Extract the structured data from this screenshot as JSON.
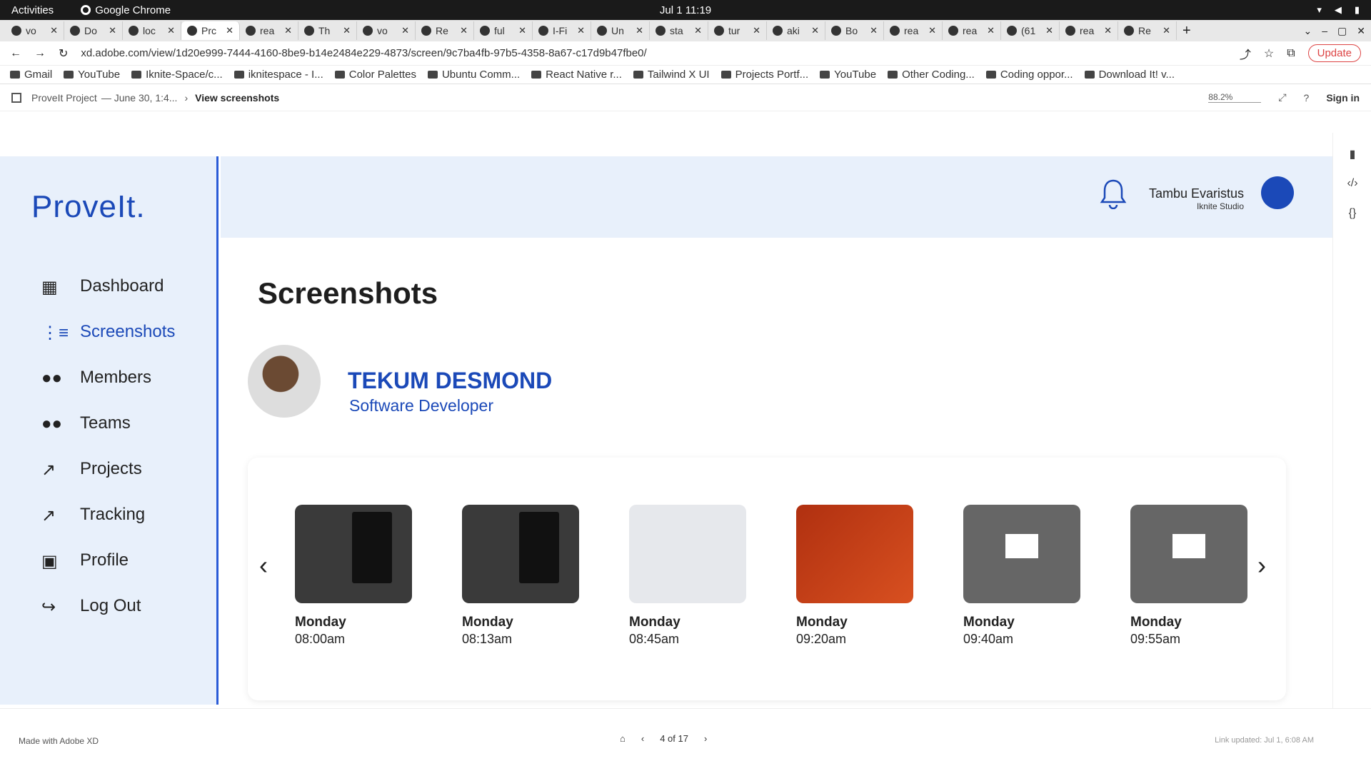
{
  "os": {
    "activities": "Activities",
    "app_name": "Google Chrome",
    "clock": "Jul 1  11:19"
  },
  "tabs": [
    {
      "label": "vo",
      "active": false
    },
    {
      "label": "Do",
      "active": false
    },
    {
      "label": "loc",
      "active": false
    },
    {
      "label": "Prc",
      "active": true
    },
    {
      "label": "rea",
      "active": false
    },
    {
      "label": "Th",
      "active": false
    },
    {
      "label": "vo",
      "active": false
    },
    {
      "label": "Re",
      "active": false
    },
    {
      "label": "ful",
      "active": false
    },
    {
      "label": "I-Fi",
      "active": false
    },
    {
      "label": "Un",
      "active": false
    },
    {
      "label": "sta",
      "active": false
    },
    {
      "label": "tur",
      "active": false
    },
    {
      "label": "aki",
      "active": false
    },
    {
      "label": "Bo",
      "active": false
    },
    {
      "label": "rea",
      "active": false
    },
    {
      "label": "rea",
      "active": false
    },
    {
      "label": "(61",
      "active": false
    },
    {
      "label": "rea",
      "active": false
    },
    {
      "label": "Re",
      "active": false
    }
  ],
  "address": {
    "url": "xd.adobe.com/view/1d20e999-7444-4160-8be9-b14e2484e229-4873/screen/9c7ba4fb-97b5-4358-8a67-c17d9b47fbe0/",
    "update_label": "Update"
  },
  "bookmarks": [
    "Gmail",
    "YouTube",
    "Iknite-Space/c...",
    "iknitespace - I...",
    "Color Palettes",
    "Ubuntu Comm...",
    "React Native r...",
    "Tailwind X UI",
    "Projects Portf...",
    "YouTube",
    "Other Coding...",
    "Coding oppor...",
    "Download It! v..."
  ],
  "xd": {
    "project": "ProveIt Project",
    "date": "— June 30, 1:4...",
    "view": "View screenshots",
    "zoom": "88.2%",
    "signin": "Sign in"
  },
  "app": {
    "logo": "ProveIt.",
    "nav": [
      "Dashboard",
      "Screenshots",
      "Members",
      "Teams",
      "Projects",
      "Tracking",
      "Profile",
      "Log Out"
    ],
    "user_name": "Tambu Evaristus",
    "user_org": "Iknite Studio",
    "page_title": "Screenshots",
    "profile_name": "TEKUM DESMOND",
    "profile_role": "Software Developer",
    "shots": [
      {
        "day": "Monday",
        "time": "08:00am"
      },
      {
        "day": "Monday",
        "time": "08:13am"
      },
      {
        "day": "Monday",
        "time": "08:45am"
      },
      {
        "day": "Monday",
        "time": "09:20am"
      },
      {
        "day": "Monday",
        "time": "09:40am"
      },
      {
        "day": "Monday",
        "time": "09:55am"
      }
    ]
  },
  "footer": {
    "made_with": "Made with Adobe XD",
    "pager": "4 of 17",
    "link_updated": "Link updated: Jul 1, 6:08 AM"
  }
}
